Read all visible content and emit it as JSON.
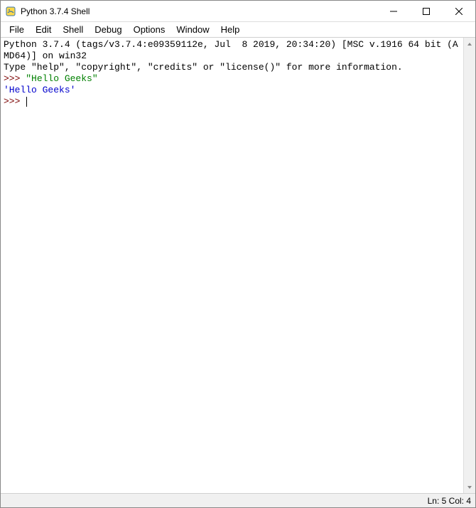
{
  "window": {
    "title": "Python 3.7.4 Shell"
  },
  "menu": {
    "items": [
      "File",
      "Edit",
      "Shell",
      "Debug",
      "Options",
      "Window",
      "Help"
    ]
  },
  "shell": {
    "banner_line1": "Python 3.7.4 (tags/v3.7.4:e09359112e, Jul  8 2019, 20:34:20) [MSC v.1916 64 bit (AMD64)] on win32",
    "banner_line2": "Type \"help\", \"copyright\", \"credits\" or \"license()\" for more information.",
    "prompt": ">>> ",
    "input1": "\"Hello Geeks\"",
    "output1": "'Hello Geeks'"
  },
  "status": {
    "text": "Ln: 5  Col: 4"
  }
}
